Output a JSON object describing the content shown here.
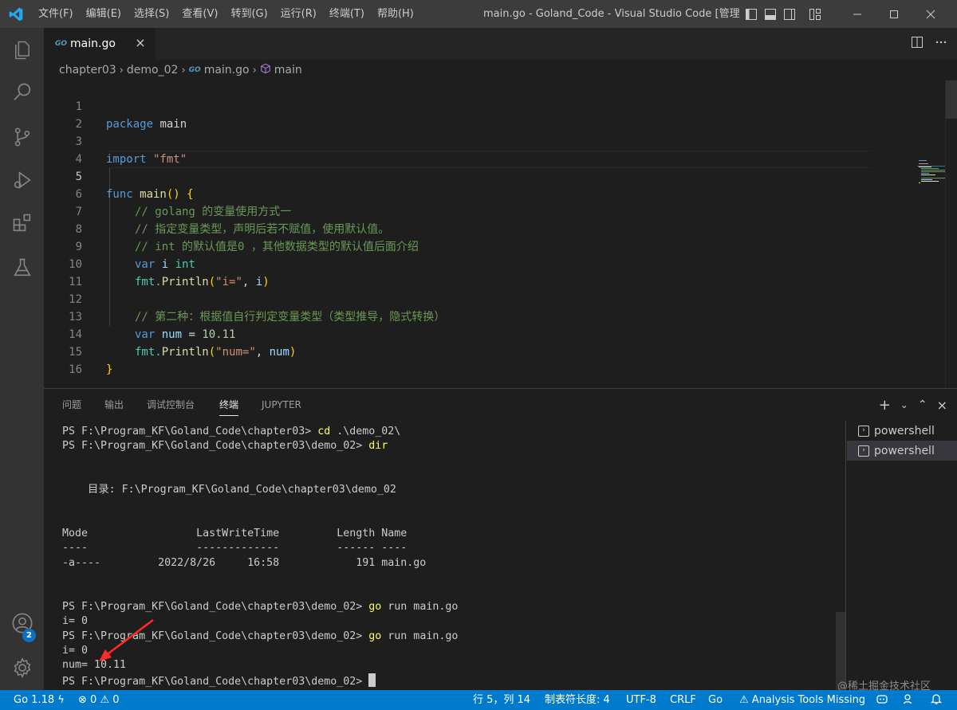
{
  "titlebar": {
    "menu": [
      "文件(F)",
      "编辑(E)",
      "选择(S)",
      "查看(V)",
      "转到(G)",
      "运行(R)",
      "终端(T)",
      "帮助(H)"
    ],
    "title": "main.go - Goland_Code - Visual Studio Code [管理..."
  },
  "activitybar": {
    "items": [
      "files-icon",
      "search-icon",
      "source-control-icon",
      "run-debug-icon",
      "extensions-icon",
      "testing-icon"
    ],
    "accounts_badge": "2"
  },
  "tab": {
    "go_badge": "GO",
    "label": "main.go",
    "close": "×"
  },
  "breadcrumb": {
    "part1": "chapter03",
    "part2": "demo_02",
    "part3": "main.go",
    "part4": "main"
  },
  "editor": {
    "lines": [
      {
        "n": "1"
      },
      {
        "n": "2"
      },
      {
        "n": "3"
      },
      {
        "n": "4"
      },
      {
        "n": "5"
      },
      {
        "n": "6"
      },
      {
        "n": "7"
      },
      {
        "n": "8"
      },
      {
        "n": "9"
      },
      {
        "n": "10"
      },
      {
        "n": "11"
      },
      {
        "n": "12"
      },
      {
        "n": "13"
      },
      {
        "n": "14"
      },
      {
        "n": "15"
      },
      {
        "n": "16"
      }
    ],
    "code": {
      "l1_kw": "package",
      "l1_name": " main",
      "l3_kw": "import",
      "l3_str": " \"fmt\"",
      "l5_kw": "func",
      "l5_fn": " main",
      "l5_paren": "()",
      "l5_brace": " {",
      "l6": "// golang 的变量使用方式一",
      "l7": "// 指定变量类型，声明后若不赋值，使用默认值。",
      "l8": "// int 的默认值是0 ，其他数据类型的默认值后面介绍",
      "l9_kw": "var",
      "l9_var": " i",
      "l9_ty": " int",
      "l10_pkg": "fmt.",
      "l10_fn": "Println",
      "l10_open": "(",
      "l10_str": "\"i=\"",
      "l10_mid": ", ",
      "l10_var": "i",
      "l10_close": ")",
      "l12": "// 第二种：根据值自行判定变量类型（类型推导，隐式转换）",
      "l13_kw": "var",
      "l13_var": " num",
      "l13_op": " = ",
      "l13_num": "10.11",
      "l14_pkg": "fmt.",
      "l14_fn": "Println",
      "l14_open": "(",
      "l14_str": "\"num=\"",
      "l14_mid": ", ",
      "l14_var": "num",
      "l14_close": ")",
      "l15": "}"
    }
  },
  "panel": {
    "tabs": [
      "问题",
      "输出",
      "调试控制台",
      "终端",
      "JUPYTER"
    ],
    "active_tab": "终端",
    "terminal": {
      "l1_prompt": "PS F:\\Program_KF\\Goland_Code\\chapter03> ",
      "l1_cmd": "cd",
      "l1_arg": " .\\demo_02\\",
      "l2_prompt": "PS F:\\Program_KF\\Goland_Code\\chapter03\\demo_02> ",
      "l2_cmd": "dir",
      "dir_line": "    目录: F:\\Program_KF\\Goland_Code\\chapter03\\demo_02",
      "header": "Mode                 LastWriteTime         Length Name",
      "underline": "----                 -------------         ------ ----",
      "row": "-a----         2022/8/26     16:58            191 main.go",
      "l3_prompt": "PS F:\\Program_KF\\Goland_Code\\chapter03\\demo_02> ",
      "l3_cmd": "go",
      "l3_arg": " run main.go",
      "out1": "i= 0",
      "l4_prompt": "PS F:\\Program_KF\\Goland_Code\\chapter03\\demo_02> ",
      "l4_cmd": "go",
      "l4_arg": " run main.go",
      "out2": "i= 0",
      "out3": "num= 10.11",
      "l5_prompt": "PS F:\\Program_KF\\Goland_Code\\chapter03\\demo_02> "
    },
    "terminals": [
      "powershell",
      "powershell"
    ]
  },
  "statusbar": {
    "go_version": "Go 1.18",
    "errors": "0",
    "warnings": "0",
    "position": "行 5，列 14",
    "tab_size": "制表符长度: 4",
    "encoding": "UTF-8",
    "eol": "CRLF",
    "language": "Go",
    "analysis": "Analysis Tools Missing"
  },
  "watermark": "@稀土掘金技术社区",
  "colors": {
    "accent": "#007acc",
    "titlebar": "#3c3c3c",
    "activitybar": "#333333"
  }
}
